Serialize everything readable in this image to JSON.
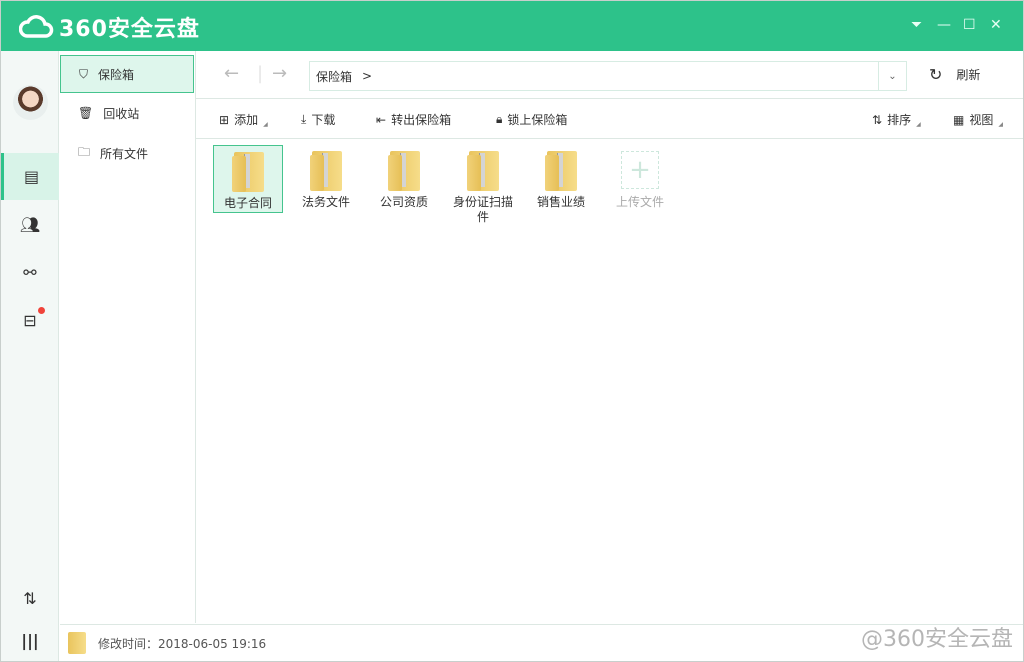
{
  "app": {
    "title": "360安全云盘",
    "accent": "#2dc28a"
  },
  "sidebar": {
    "items": [
      {
        "label": "保险箱",
        "icon": "shield-icon"
      },
      {
        "label": "回收站",
        "icon": "trash-icon"
      },
      {
        "label": "所有文件",
        "icon": "folder-icon"
      }
    ]
  },
  "nav": {
    "path": "保险箱",
    "separator": ">",
    "refresh": "刷新"
  },
  "toolbar": {
    "add": "添加",
    "download": "下载",
    "export": "转出保险箱",
    "lock": "锁上保险箱",
    "sort": "排序",
    "view": "视图"
  },
  "files": [
    {
      "name": "电子合同"
    },
    {
      "name": "法务文件"
    },
    {
      "name": "公司资质"
    },
    {
      "name": "身份证扫描件"
    },
    {
      "name": "销售业绩"
    }
  ],
  "upload": {
    "label": "上传文件"
  },
  "status": {
    "text": "修改时间：2018-06-05 19:16"
  },
  "watermark": "@360安全云盘"
}
